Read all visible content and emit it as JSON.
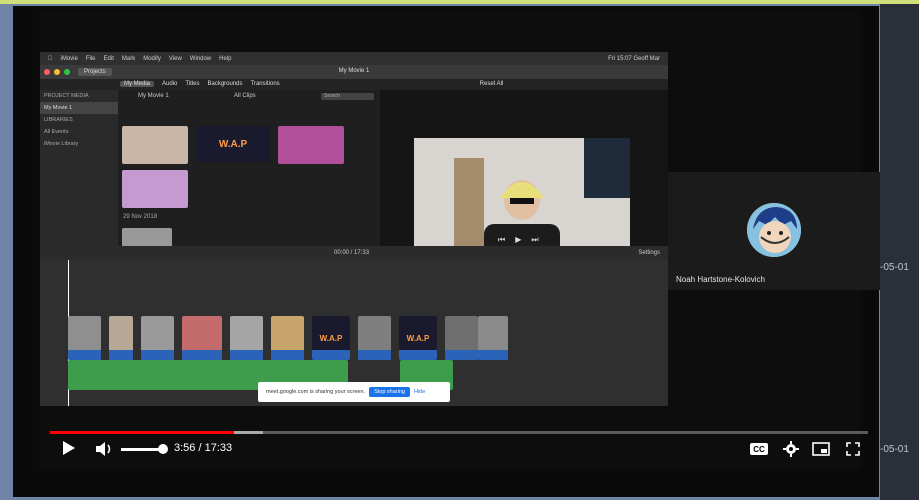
{
  "player": {
    "current_time": "3:56",
    "separator": " / ",
    "duration": "17:33",
    "progress_fraction": 0.2245,
    "buffered_fraction": 0.26,
    "volume_fraction": 1.0,
    "controls": {
      "play": "play-icon",
      "volume": "volume-icon",
      "captions": "cc-icon",
      "settings": "gear-icon",
      "miniplayer": "miniplayer-icon",
      "fullscreen": "fullscreen-icon"
    },
    "captions_label": "CC"
  },
  "participant": {
    "name": "Noah Hartstone-Kolovich"
  },
  "side_dates": [
    "-05-01",
    "-05-01"
  ],
  "imovie": {
    "menu": [
      "iMovie",
      "File",
      "Edit",
      "Mark",
      "Modify",
      "View",
      "Window",
      "Help"
    ],
    "status": "Fri 15:07  Geoff Mar",
    "projects_button": "Projects",
    "window_title": "My Movie 1",
    "tabs": [
      "My Media",
      "Audio",
      "Titles",
      "Backgrounds",
      "Transitions"
    ],
    "sidebar": {
      "heading1": "PROJECT MEDIA",
      "project": "My Movie 1",
      "heading2": "LIBRARIES",
      "all_events": "All Events",
      "library": "iMovie Library"
    },
    "media_title": "My Movie 1",
    "filter": "All Clips",
    "search_placeholder": "Search",
    "date_group": "29 Nov 2018",
    "wap_text": "W.A.P",
    "timecode": "00:00 / 17:33",
    "settings": "Settings",
    "reset": "Reset All"
  },
  "share_banner": {
    "message": "meet.google.com is sharing your screen.",
    "stop": "Stop sharing",
    "hide": "Hide"
  },
  "colors": {
    "accent_red": "#ff0000",
    "clip_blue": "#2a63b8",
    "audio_green": "#3e9d4c",
    "wap_orange": "#ff9d47"
  }
}
